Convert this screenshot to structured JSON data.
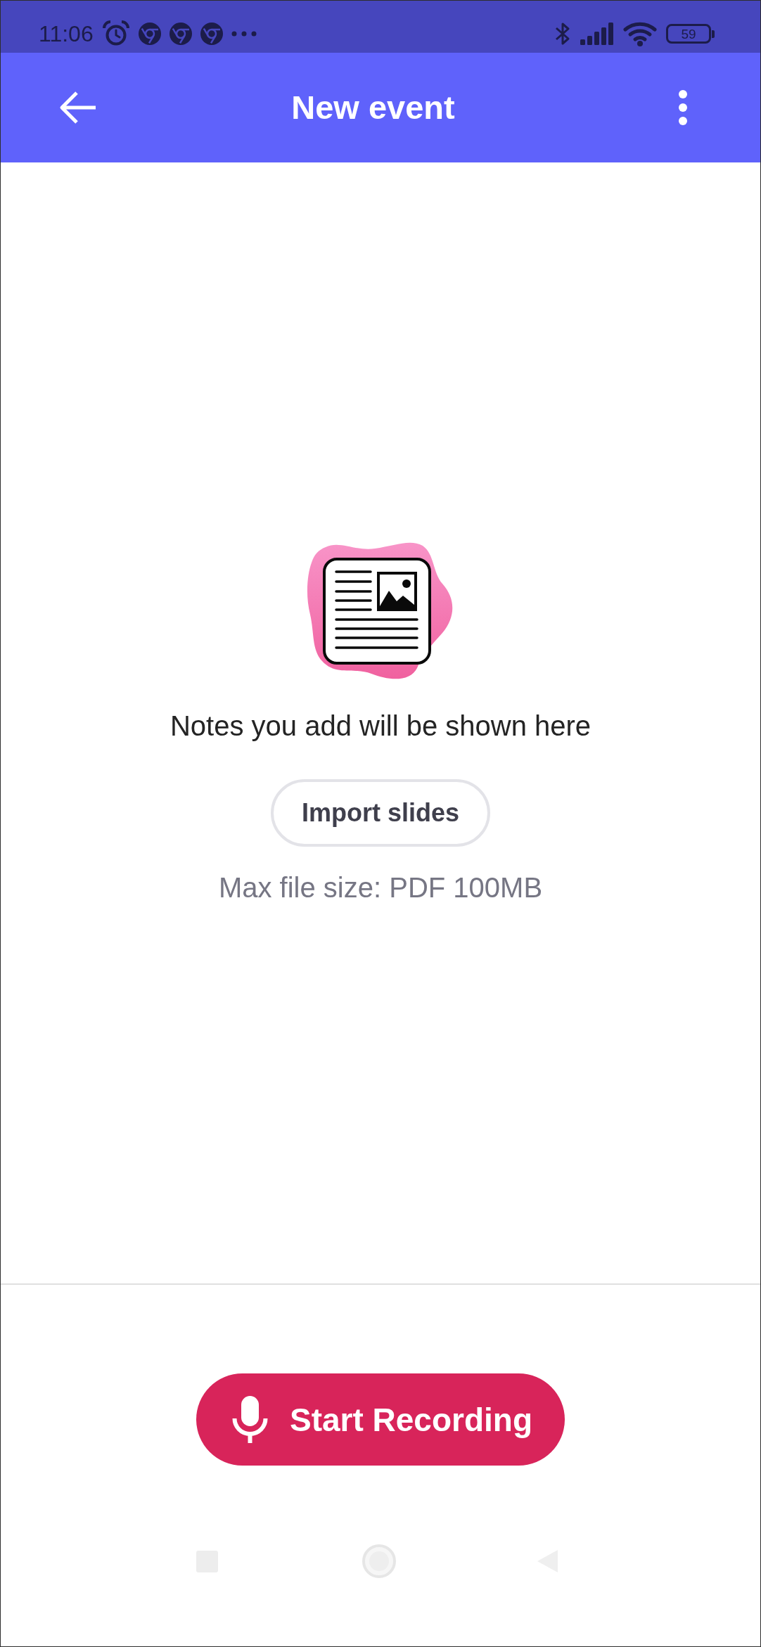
{
  "status_bar": {
    "time": "11:06",
    "battery": "59"
  },
  "app_bar": {
    "title": "New event"
  },
  "empty_state": {
    "message": "Notes you add will be shown here",
    "import_button": "Import slides",
    "hint": "Max file size: PDF 100MB"
  },
  "record_button": {
    "label": "Start Recording"
  }
}
